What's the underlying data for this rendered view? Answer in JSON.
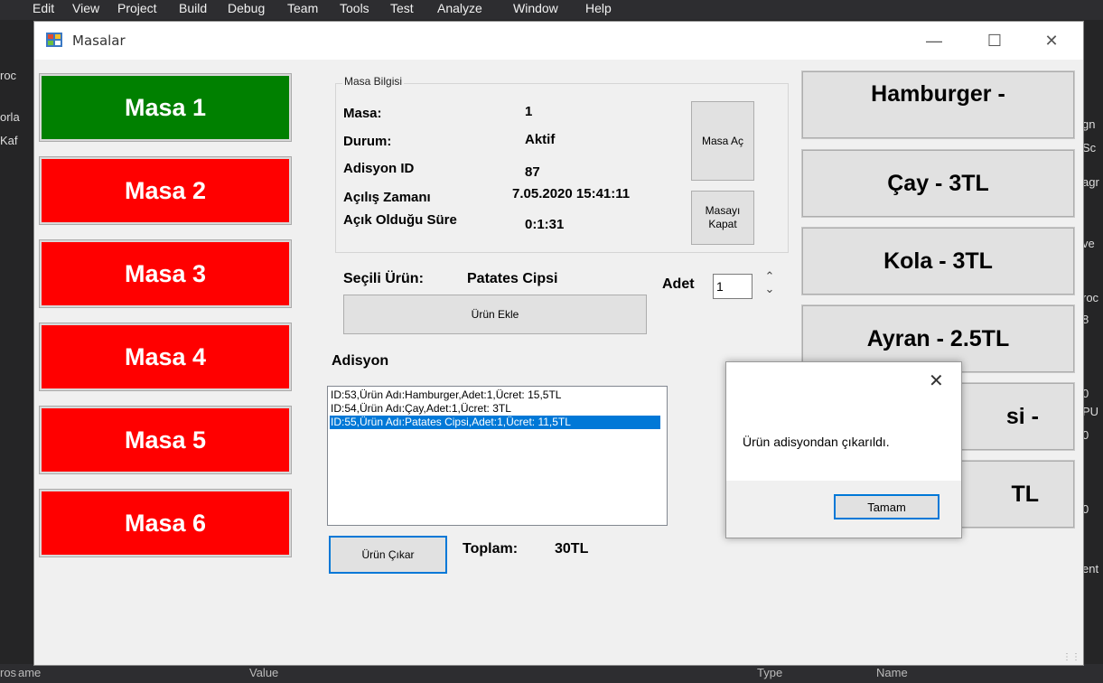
{
  "ide": {
    "menu": [
      "Edit",
      "View",
      "Project",
      "Build",
      "Debug",
      "Team",
      "Tools",
      "Test",
      "Analyze",
      "Window",
      "Help"
    ],
    "left_fragments": [
      "roc",
      "orla",
      "Kaf"
    ],
    "right_fragments": [
      "gn",
      "Sc",
      "agr",
      "ve",
      "roc",
      "8",
      "0",
      "PU",
      "0",
      "0",
      "ent"
    ],
    "bottom": [
      "ros",
      "ame",
      "Value",
      "Type",
      "Name"
    ]
  },
  "window": {
    "title": "Masalar",
    "controls": {
      "minimize": "—",
      "maximize": "☐",
      "close": "✕"
    }
  },
  "tables": [
    {
      "label": "Masa 1",
      "color": "#008000"
    },
    {
      "label": "Masa 2",
      "color": "#ff0000"
    },
    {
      "label": "Masa 3",
      "color": "#ff0000"
    },
    {
      "label": "Masa 4",
      "color": "#ff0000"
    },
    {
      "label": "Masa 5",
      "color": "#ff0000"
    },
    {
      "label": "Masa 6",
      "color": "#ff0000"
    }
  ],
  "info": {
    "legend": "Masa Bilgisi",
    "masa_label": "Masa:",
    "masa_value": "1",
    "durum_label": "Durum:",
    "durum_value": "Aktif",
    "adisyon_label": "Adisyon ID",
    "adisyon_value": "87",
    "acilis_label": "Açılış Zamanı",
    "acilis_value": "7.05.2020 15:41:11",
    "sure_label": "Açık Olduğu Süre",
    "sure_value": "0:1:31",
    "open_button": "Masa Aç",
    "close_button_line1": "Masayı",
    "close_button_line2": "Kapat"
  },
  "selection": {
    "label": "Seçili Ürün:",
    "value": "Patates Cipsi",
    "adet_label": "Adet",
    "adet_value": "1",
    "add_button": "Ürün Ekle"
  },
  "adisyon": {
    "heading": "Adisyon",
    "items": [
      "ID:53,Ürün Adı:Hamburger,Adet:1,Ücret: 15,5TL",
      "ID:54,Ürün Adı:Çay,Adet:1,Ücret: 3TL",
      "ID:55,Ürün Adı:Patates Cipsi,Adet:1,Ücret: 11,5TL"
    ],
    "selected_index": 2,
    "remove_button": "Ürün Çıkar",
    "total_label": "Toplam:",
    "total_value": "30TL"
  },
  "products": [
    "Hamburger -",
    "Çay - 3TL",
    "Kola - 3TL",
    "Ayran - 2.5TL",
    "si -",
    "TL"
  ],
  "dialog": {
    "message": "Ürün adisyondan çıkarıldı.",
    "ok_button": "Tamam",
    "close": "✕"
  }
}
